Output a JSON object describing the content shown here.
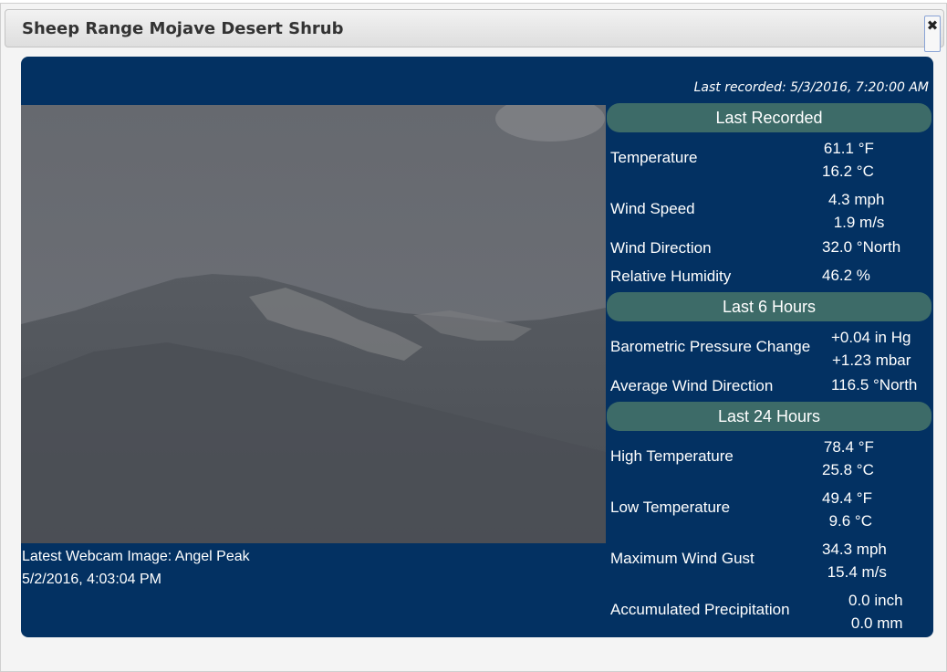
{
  "dialog": {
    "title": "Sheep Range Mojave Desert Shrub",
    "close_label": "✖"
  },
  "panel": {
    "last_recorded_text": "Last recorded: 5/3/2016, 7:20:00 AM",
    "webcam": {
      "caption_line1": "Latest Webcam Image: Angel Peak",
      "caption_line2": "5/2/2016, 4:03:04 PM"
    },
    "sections": [
      {
        "header": "Last Recorded",
        "rows": [
          {
            "label": "Temperature",
            "values": [
              "61.1 °F",
              "16.2 °C"
            ]
          },
          {
            "label": "Wind Speed",
            "values": [
              "4.3 mph",
              "1.9 m/s"
            ]
          },
          {
            "label": "Wind Direction",
            "values": [
              "32.0 °North"
            ]
          },
          {
            "label": "Relative Humidity",
            "values": [
              "46.2 %"
            ]
          }
        ]
      },
      {
        "header": "Last 6 Hours",
        "rows": [
          {
            "label": "Barometric Pressure Change",
            "values": [
              "+0.04 in Hg",
              "+1.23 mbar"
            ]
          },
          {
            "label": "Average Wind Direction",
            "values": [
              "116.5 °North"
            ]
          }
        ]
      },
      {
        "header": "Last 24 Hours",
        "rows": [
          {
            "label": "High Temperature",
            "values": [
              "78.4 °F",
              "25.8 °C"
            ]
          },
          {
            "label": "Low Temperature",
            "values": [
              "49.4 °F",
              "9.6 °C"
            ]
          },
          {
            "label": "Maximum Wind Gust",
            "values": [
              "34.3 mph",
              "15.4 m/s"
            ]
          },
          {
            "label": "Accumulated Precipitation",
            "values": [
              "0.0 inch",
              "0.0 mm"
            ]
          }
        ]
      }
    ]
  }
}
